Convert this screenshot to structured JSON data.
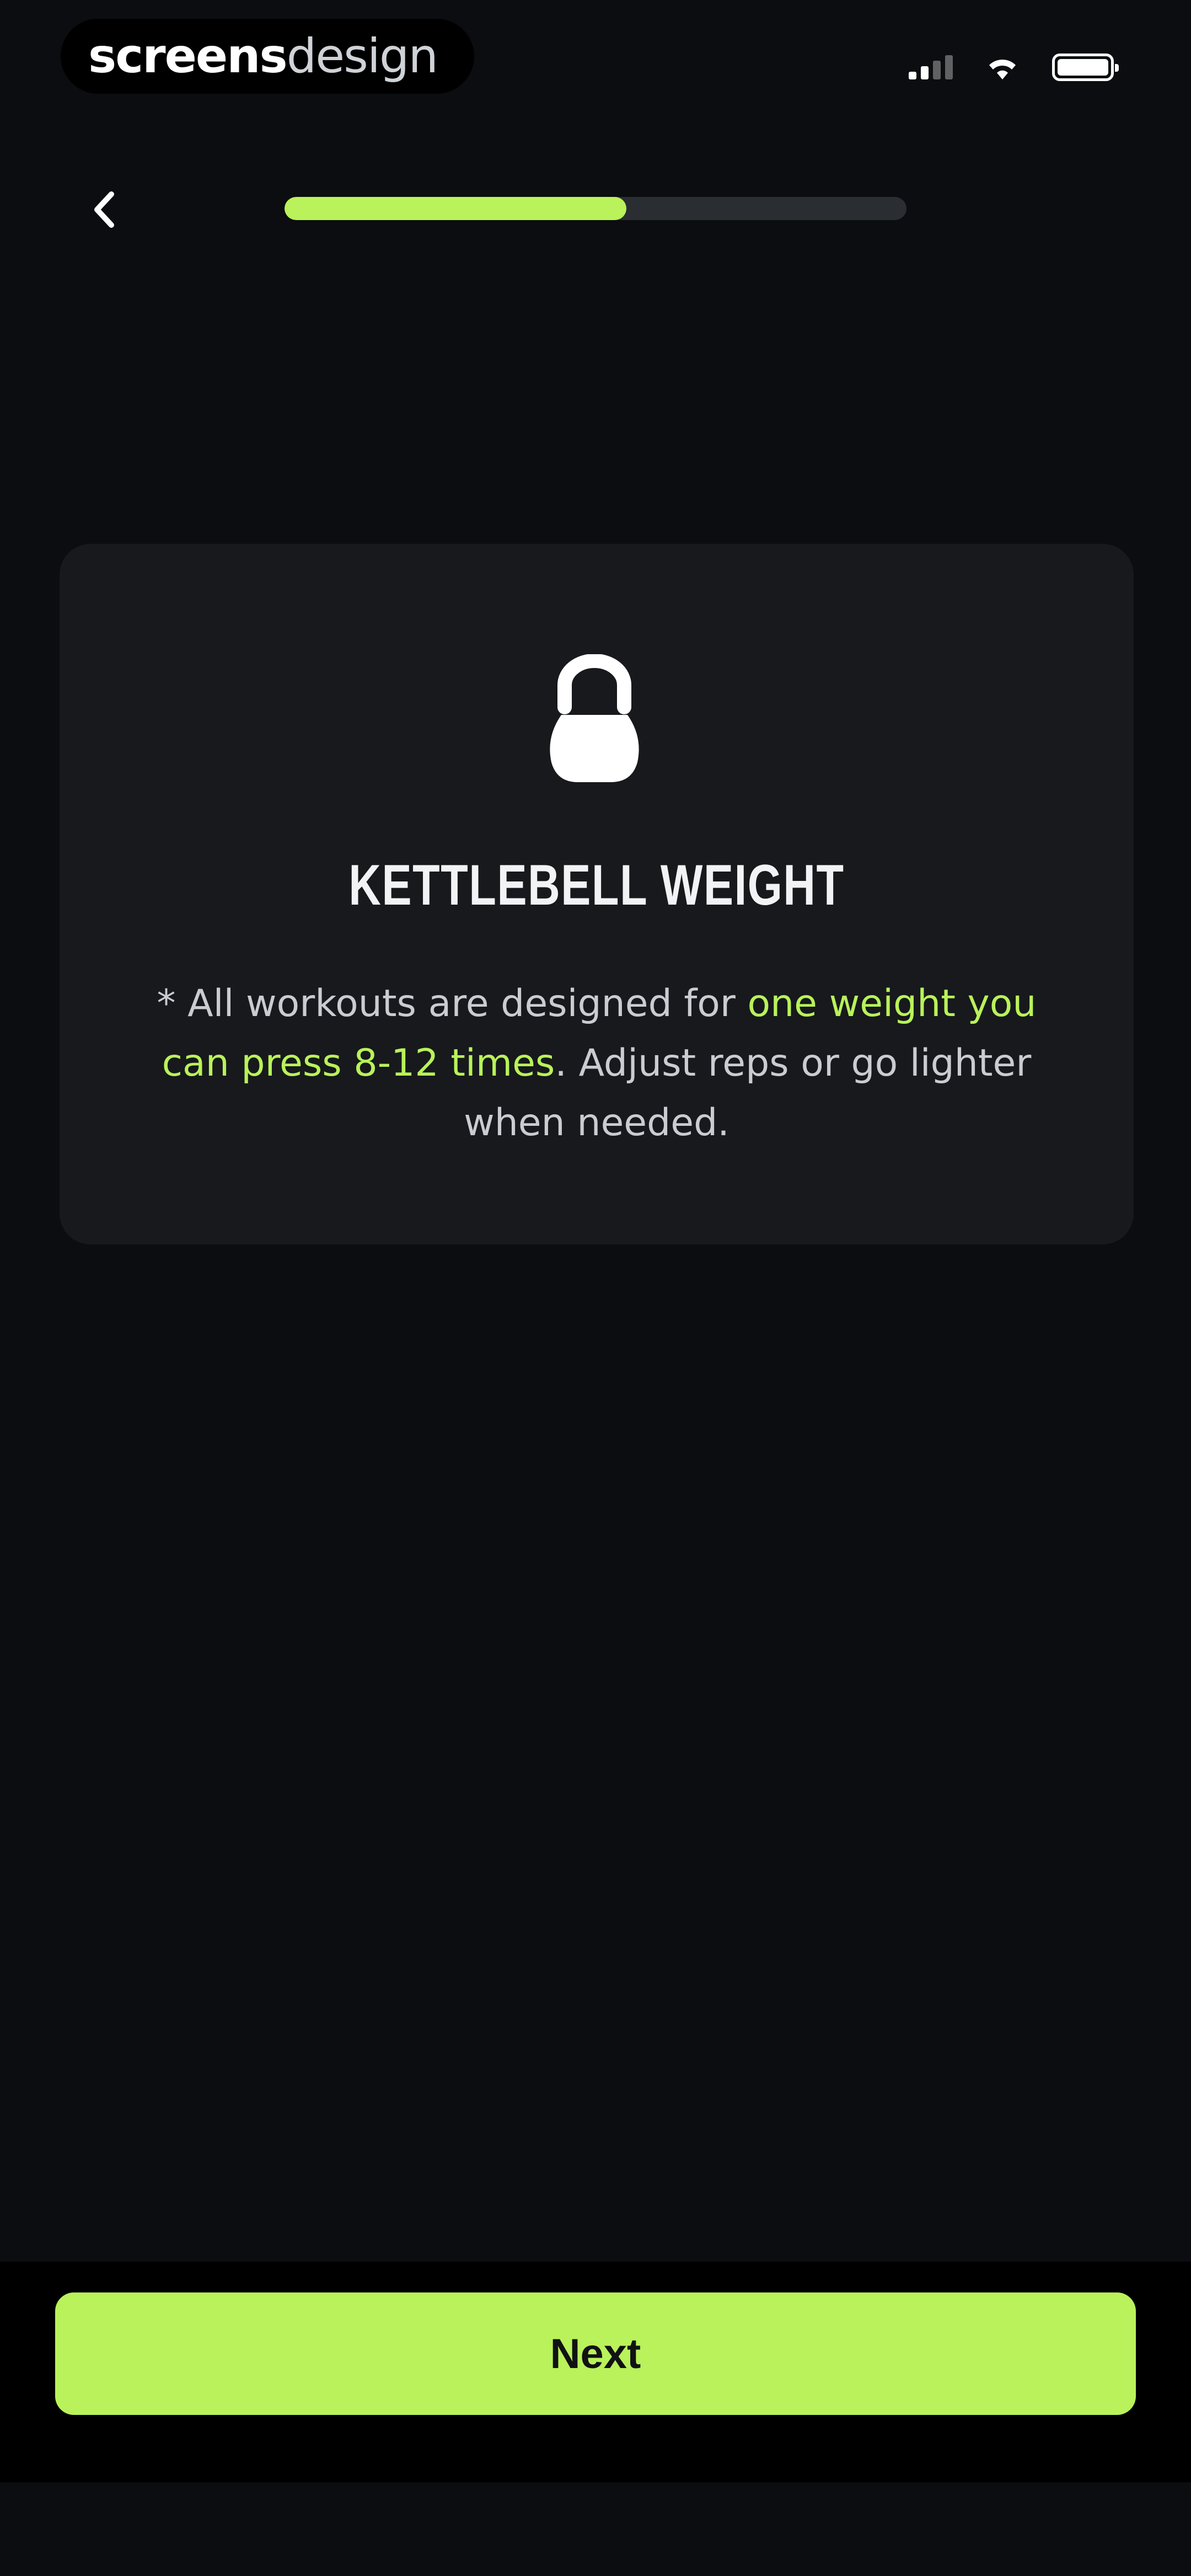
{
  "status_bar": {
    "brand_part1": "screens",
    "brand_part2": "design",
    "icons": [
      "cellular-signal-icon",
      "wifi-icon",
      "battery-icon"
    ]
  },
  "header": {
    "back_icon": "chevron-left-icon",
    "progress_fraction": 0.55
  },
  "card": {
    "icon": "kettlebell-icon",
    "title": "KETTLEBELL WEIGHT",
    "text_before": "* All workouts are designed for ",
    "text_highlight": "one weight you can press 8-12 times",
    "text_after": ". Adjust reps or go lighter when needed."
  },
  "footer": {
    "next_label": "Next"
  },
  "colors": {
    "background": "#0b0d10",
    "card": "#17191c",
    "accent": "#b9f25a",
    "track": "#2a2d31"
  }
}
